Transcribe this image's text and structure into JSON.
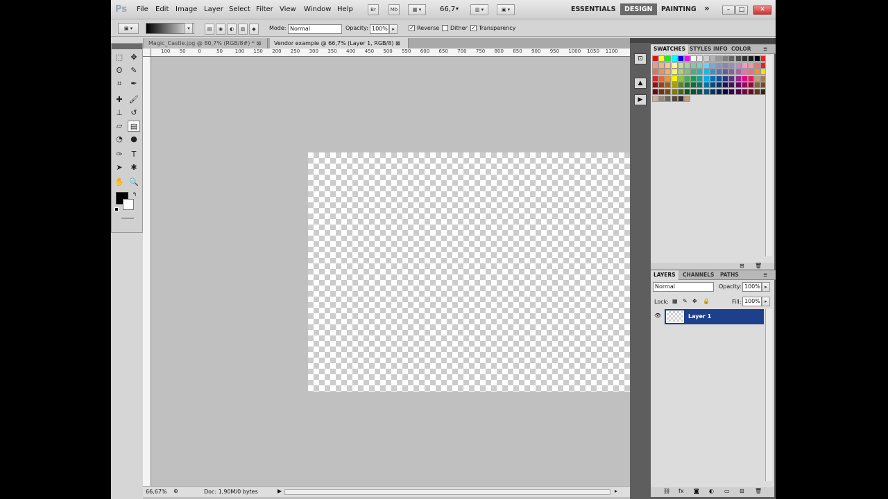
{
  "menubar": {
    "logo": "Ps",
    "items": [
      "File",
      "Edit",
      "Image",
      "Layer",
      "Select",
      "Filter",
      "View",
      "Window",
      "Help"
    ],
    "bridge_btn": "Br",
    "minibridge_btn": "Mb",
    "zoom_value": "66,7",
    "workspaces": [
      "ESSENTIALS",
      "DESIGN",
      "PAINTING"
    ],
    "more": "»"
  },
  "options": {
    "mode_label": "Mode:",
    "mode_value": "Normal",
    "opacity_label": "Opacity:",
    "opacity_value": "100%",
    "reverse": "Reverse",
    "dither": "Dither",
    "transparency": "Transparency"
  },
  "tabs": [
    {
      "label": "Magic_Castle.jpg @ 80,7% (RGB/8#) *"
    },
    {
      "label": "Vendor example @ 66,7% (Layer 1, RGB/8)"
    }
  ],
  "ruler_ticks": [
    "100",
    "50",
    "0",
    "50",
    "100",
    "150",
    "200",
    "250",
    "300",
    "350",
    "400",
    "450",
    "500",
    "550",
    "600",
    "650",
    "700",
    "750",
    "800",
    "850",
    "900",
    "950",
    "1000",
    "1050",
    "1100"
  ],
  "status": {
    "zoom": "66,67%",
    "doc": "Doc: 1,90M/0 bytes"
  },
  "swatches_panel": {
    "tabs": [
      "SWATCHES",
      "STYLES",
      "INFO",
      "COLOR"
    ]
  },
  "layers_panel": {
    "tabs": [
      "LAYERS",
      "CHANNELS",
      "PATHS"
    ],
    "blend_mode": "Normal",
    "opacity_label": "Opacity:",
    "opacity_value": "100%",
    "lock_label": "Lock:",
    "fill_label": "Fill:",
    "fill_value": "100%",
    "layer_name": "Layer 1"
  },
  "swatch_colors": [
    [
      "#ff0000",
      "#ffff00",
      "#00ff00",
      "#00ffff",
      "#0000ff",
      "#ff00ff",
      "#ffffff",
      "#e6e6e6",
      "#cccccc",
      "#b3b3b3",
      "#999999",
      "#808080",
      "#666666",
      "#4d4d4d",
      "#333333",
      "#1a1a1a",
      "#000000",
      "#ee1d24"
    ],
    [
      "#f7977a",
      "#f9ad81",
      "#fdc68a",
      "#fff79a",
      "#c4df9b",
      "#a3d39c",
      "#82ca9d",
      "#7bcdc8",
      "#6ecff6",
      "#7ea7d8",
      "#8493ca",
      "#8882be",
      "#a187be",
      "#bc8dbf",
      "#f49ac2",
      "#f6989d",
      "#ff6f6f",
      "#ed1c24"
    ],
    [
      "#f26c4f",
      "#f68e55",
      "#fbaf5c",
      "#fff467",
      "#acd372",
      "#7cc576",
      "#3bb878",
      "#1abbb4",
      "#00bff3",
      "#438ccb",
      "#5574b9",
      "#605ca8",
      "#855fa8",
      "#a763a8",
      "#f06ea9",
      "#f26d7d",
      "#f7941d",
      "#ffdd00"
    ],
    [
      "#ed1c24",
      "#f26522",
      "#f7941d",
      "#fff200",
      "#8dc73f",
      "#39b54a",
      "#00a651",
      "#00a99d",
      "#00aeef",
      "#0072bc",
      "#0054a6",
      "#2e3192",
      "#662d91",
      "#92278f",
      "#ec008c",
      "#ed145b",
      "#c69c6d",
      "#a67c52"
    ],
    [
      "#9e0b0f",
      "#a0410d",
      "#a36209",
      "#aba000",
      "#598527",
      "#1a7b30",
      "#007236",
      "#00746b",
      "#0076a3",
      "#004b80",
      "#003471",
      "#1b1464",
      "#440e62",
      "#630460",
      "#9e005d",
      "#9e0039",
      "#8c6239",
      "#754c24"
    ],
    [
      "#790000",
      "#7b2e00",
      "#7d4900",
      "#827b00",
      "#406618",
      "#005e20",
      "#005826",
      "#005952",
      "#005b7f",
      "#003663",
      "#002157",
      "#0d004c",
      "#32004b",
      "#4b0049",
      "#7b0046",
      "#7a0026",
      "#603913",
      "#3c2415"
    ],
    [
      "#c7b299",
      "#998675",
      "#736357",
      "#534741",
      "#362f2d",
      "#c69c6d"
    ]
  ]
}
